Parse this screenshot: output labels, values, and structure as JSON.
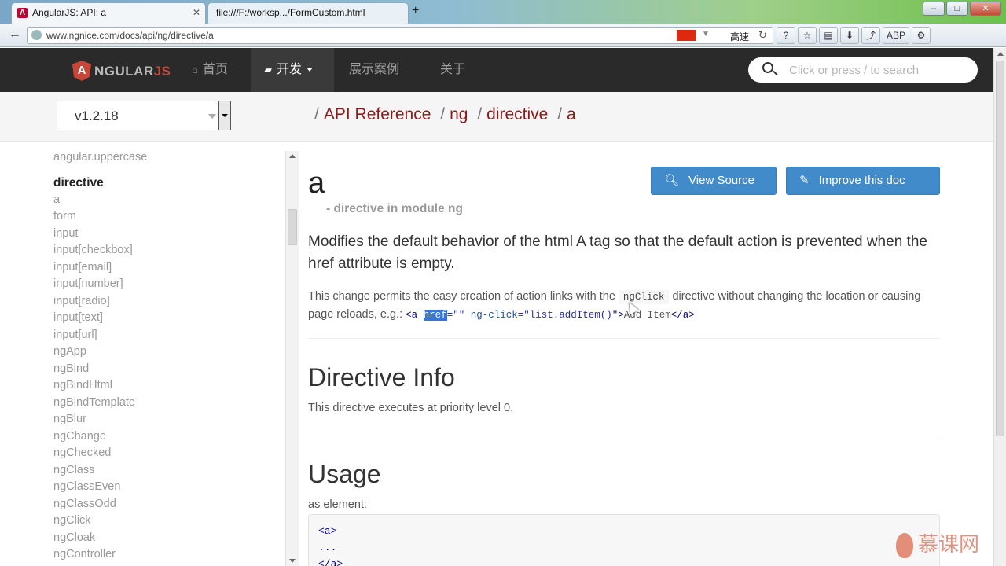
{
  "browser": {
    "tabs": [
      {
        "title": "AngularJS: API: a",
        "fav": "A"
      },
      {
        "title": "file:///F:/worksp.../FormCustom.html"
      }
    ],
    "new_tab": "+",
    "url": "www.ngnice.com/docs/api/ng/directive/a",
    "speed_label": "高速",
    "window_buttons": {
      "min": "–",
      "max": "□",
      "close": "✕"
    },
    "toolbar": [
      "?",
      "☆",
      "▤",
      "⬇",
      "⤴",
      "ABP",
      "⚙"
    ]
  },
  "site": {
    "logo": {
      "letter": "A",
      "word_main": "NGULAR",
      "word_accent": "JS"
    },
    "nav": [
      {
        "label": "首页",
        "icon": "home-icon",
        "glyph": "⌂"
      },
      {
        "label": "开发",
        "icon": "book-icon",
        "glyph": "▰"
      },
      {
        "label": "展示案例"
      },
      {
        "label": "关于"
      }
    ],
    "search_placeholder": "Click or press / to search"
  },
  "subheader": {
    "version": "v1.2.18",
    "breadcrumb": [
      "API Reference",
      "ng",
      "directive",
      "a"
    ]
  },
  "sidebar": {
    "top_link": "angular.uppercase",
    "heading": "directive",
    "items": [
      "a",
      "form",
      "input",
      "input[checkbox]",
      "input[email]",
      "input[number]",
      "input[radio]",
      "input[text]",
      "input[url]",
      "ngApp",
      "ngBind",
      "ngBindHtml",
      "ngBindTemplate",
      "ngBlur",
      "ngChange",
      "ngChecked",
      "ngClass",
      "ngClassEven",
      "ngClassOdd",
      "ngClick",
      "ngCloak",
      "ngController"
    ]
  },
  "content": {
    "title": "a",
    "buttons": {
      "view_source": "View Source",
      "improve": "Improve this doc"
    },
    "subtitle": "- directive in module ng",
    "lead": "Modifies the default behavior of the html A tag so that the default action is prevented when the href attribute is empty.",
    "para_part1": "This change permits the easy creation of action links with the ",
    "para_code": "ngClick",
    "para_part2": " directive without changing the location or causing page reloads, e.g.: ",
    "snippet": {
      "open": "<a ",
      "href": "href",
      "eq1": "=\"\" ",
      "ngclick": "ng-click",
      "eq2": "=\"",
      "value": "list.addItem()",
      "close": "\">",
      "text": "Add Item",
      "end": "</a>"
    },
    "directive_info_heading": "Directive Info",
    "directive_info_text": "This directive executes at priority level 0.",
    "usage_heading": "Usage",
    "usage_text": "as element:",
    "code_lines": [
      "<a>",
      "...",
      "</a>"
    ]
  },
  "watermark": "慕课网"
}
